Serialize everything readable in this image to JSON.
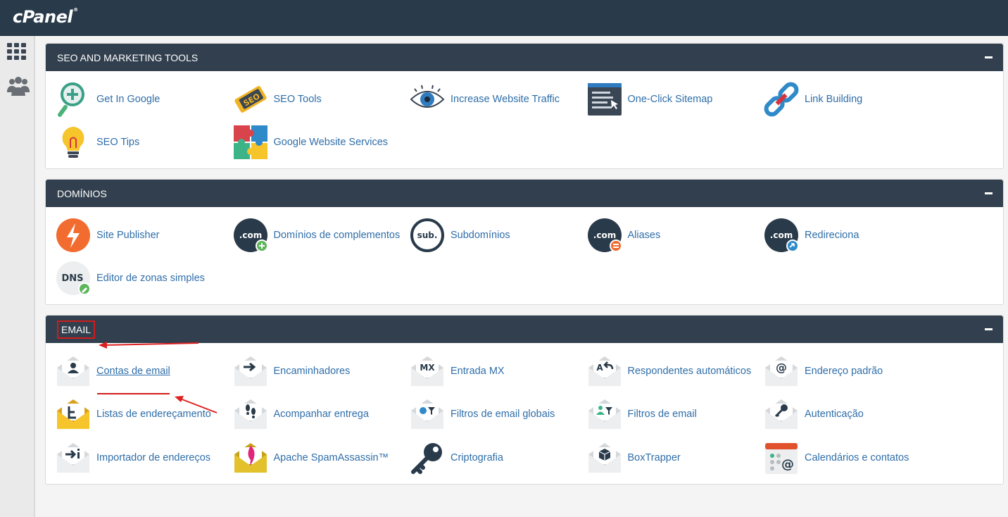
{
  "brand": {
    "logo": "cPanel",
    "logo_mark": "®"
  },
  "sidebar": {
    "items": [
      {
        "icon": "grid-icon"
      },
      {
        "icon": "users-icon"
      }
    ]
  },
  "colors": {
    "header": "#293a4a",
    "panel_header": "#313f4e",
    "link": "#2f6ea9",
    "highlight": "#d21c1c"
  },
  "sections": {
    "seo": {
      "title": "SEO AND MARKETING TOOLS",
      "items": [
        {
          "label": "Get In Google",
          "icon": "magnify-plus-icon"
        },
        {
          "label": "SEO Tools",
          "icon": "seo-tag-icon"
        },
        {
          "label": "Increase Website Traffic",
          "icon": "eye-icon"
        },
        {
          "label": "One-Click Sitemap",
          "icon": "sitemap-window-icon"
        },
        {
          "label": "Link Building",
          "icon": "chain-link-icon"
        },
        {
          "label": "SEO Tips",
          "icon": "lightbulb-icon"
        },
        {
          "label": "Google Website Services",
          "icon": "puzzle-icon"
        }
      ]
    },
    "domains": {
      "title": "DOMÍNIOS",
      "items": [
        {
          "label": "Site Publisher",
          "icon": "bolt-icon",
          "badge": ""
        },
        {
          "label": "Domínios de complementos",
          "icon": "dotcom-add-icon",
          "badge": ".com"
        },
        {
          "label": "Subdomínios",
          "icon": "subdomain-icon",
          "badge": "sub."
        },
        {
          "label": "Aliases",
          "icon": "dotcom-alias-icon",
          "badge": ".com"
        },
        {
          "label": "Redireciona",
          "icon": "dotcom-redirect-icon",
          "badge": ".com"
        },
        {
          "label": "Editor de zonas simples",
          "icon": "dns-edit-icon",
          "badge": "DNS"
        }
      ]
    },
    "email": {
      "title": "EMAIL",
      "items": [
        {
          "label": "Contas de email",
          "icon": "envelope-user-icon"
        },
        {
          "label": "Encaminhadores",
          "icon": "envelope-forward-icon"
        },
        {
          "label": "Entrada MX",
          "icon": "envelope-mx-icon",
          "badge": "MX"
        },
        {
          "label": "Respondentes automáticos",
          "icon": "envelope-autoreply-icon"
        },
        {
          "label": "Endereço padrão",
          "icon": "envelope-at-icon"
        },
        {
          "label": "Listas de endereçamento",
          "icon": "envelope-list-icon"
        },
        {
          "label": "Acompanhar entrega",
          "icon": "envelope-footprints-icon"
        },
        {
          "label": "Filtros de email globais",
          "icon": "envelope-global-filter-icon"
        },
        {
          "label": "Filtros de email",
          "icon": "envelope-user-filter-icon"
        },
        {
          "label": "Autenticação",
          "icon": "envelope-key-icon"
        },
        {
          "label": "Importador de endereços",
          "icon": "envelope-import-icon"
        },
        {
          "label": "Apache SpamAssassin™",
          "icon": "envelope-feather-icon"
        },
        {
          "label": "Criptografia",
          "icon": "key-icon"
        },
        {
          "label": "BoxTrapper",
          "icon": "envelope-box-icon"
        },
        {
          "label": "Calendários e contatos",
          "icon": "calendar-contacts-icon"
        }
      ]
    }
  }
}
